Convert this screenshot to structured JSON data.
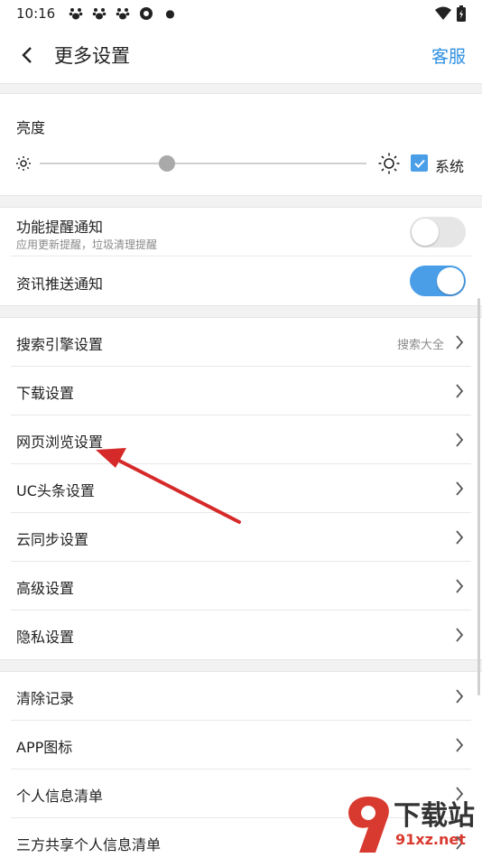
{
  "status_bar": {
    "time": "10:16",
    "notifications": [
      "paw-icon",
      "paw-icon",
      "paw-icon",
      "aperture-icon"
    ]
  },
  "header": {
    "title": "更多设置",
    "action": "客服"
  },
  "brightness": {
    "title": "亮度",
    "level": 0.39,
    "system_label": "系统",
    "system_checked": true
  },
  "notifications": [
    {
      "label": "功能提醒通知",
      "sub": "应用更新提醒，垃圾清理提醒",
      "on": false
    },
    {
      "label": "资讯推送通知",
      "sub": "",
      "on": true
    }
  ],
  "settings": [
    {
      "label": "搜索引擎设置",
      "value": "搜索大全"
    },
    {
      "label": "下载设置",
      "value": ""
    },
    {
      "label": "网页浏览设置",
      "value": ""
    },
    {
      "label": "UC头条设置",
      "value": ""
    },
    {
      "label": "云同步设置",
      "value": ""
    },
    {
      "label": "高级设置",
      "value": ""
    },
    {
      "label": "隐私设置",
      "value": ""
    }
  ],
  "other": [
    {
      "label": "清除记录"
    },
    {
      "label": "APP图标"
    },
    {
      "label": "个人信息清单"
    },
    {
      "label": "三方共享个人信息清单"
    }
  ],
  "watermark": {
    "brand": "下载站",
    "site": "91xz.net"
  },
  "colors": {
    "accent": "#2d8fe0",
    "toggle_on": "#4a9ee8",
    "arrow": "#d62a2a"
  }
}
